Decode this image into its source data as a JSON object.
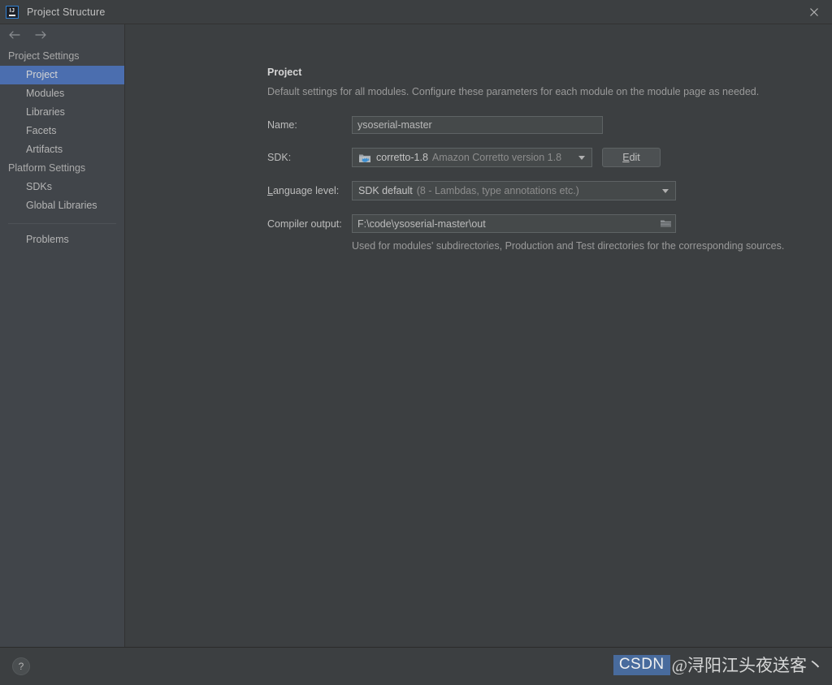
{
  "window": {
    "title": "Project Structure",
    "app_icon": "intellij-idea-icon",
    "close_icon": "close-icon"
  },
  "nav": {
    "back_icon": "arrow-left-icon",
    "forward_icon": "arrow-right-icon"
  },
  "sidebar": {
    "groups": [
      {
        "label": "Project Settings",
        "items": [
          {
            "label": "Project",
            "selected": true
          },
          {
            "label": "Modules",
            "selected": false
          },
          {
            "label": "Libraries",
            "selected": false
          },
          {
            "label": "Facets",
            "selected": false
          },
          {
            "label": "Artifacts",
            "selected": false
          }
        ]
      },
      {
        "label": "Platform Settings",
        "items": [
          {
            "label": "SDKs",
            "selected": false
          },
          {
            "label": "Global Libraries",
            "selected": false
          }
        ]
      }
    ],
    "problems": {
      "label": "Problems"
    }
  },
  "main": {
    "title": "Project",
    "description": "Default settings for all modules. Configure these parameters for each module on the module page as needed.",
    "name": {
      "label": "Name:",
      "value": "ysoserial-master"
    },
    "sdk": {
      "label": "SDK:",
      "value": "corretto-1.8",
      "detail": "Amazon Corretto version 1.8",
      "icon": "java-sdk-folder-icon",
      "caret_icon": "chevron-down-icon",
      "edit_button": {
        "label_prefix": "E",
        "label_rest": "dit",
        "label": "Edit"
      }
    },
    "language_level": {
      "label_prefix": "L",
      "label_rest": "anguage level:",
      "label": "Language level:",
      "value": "SDK default",
      "detail": "(8 - Lambdas, type annotations etc.)",
      "caret_icon": "chevron-down-icon"
    },
    "compiler_output": {
      "label": "Compiler output:",
      "value": "F:\\code\\ysoserial-master\\out",
      "browse_icon": "folder-browse-icon",
      "hint": "Used for modules' subdirectories, Production and Test directories for the corresponding sources."
    }
  },
  "footer": {
    "help_label": "?",
    "help_icon": "help-question-icon"
  },
  "watermark": {
    "badge": "CSDN",
    "text": "@浔阳江头夜送客丶"
  },
  "colors": {
    "accent_selection": "#4b6eaf",
    "window_bg": "#3c3f41",
    "sidebar_bg": "#41454a",
    "field_bg": "#45494a",
    "border": "#5e6364",
    "text": "#bbbbbb",
    "text_muted": "#9a9a9a",
    "watermark_badge": "#4a6fa5"
  }
}
